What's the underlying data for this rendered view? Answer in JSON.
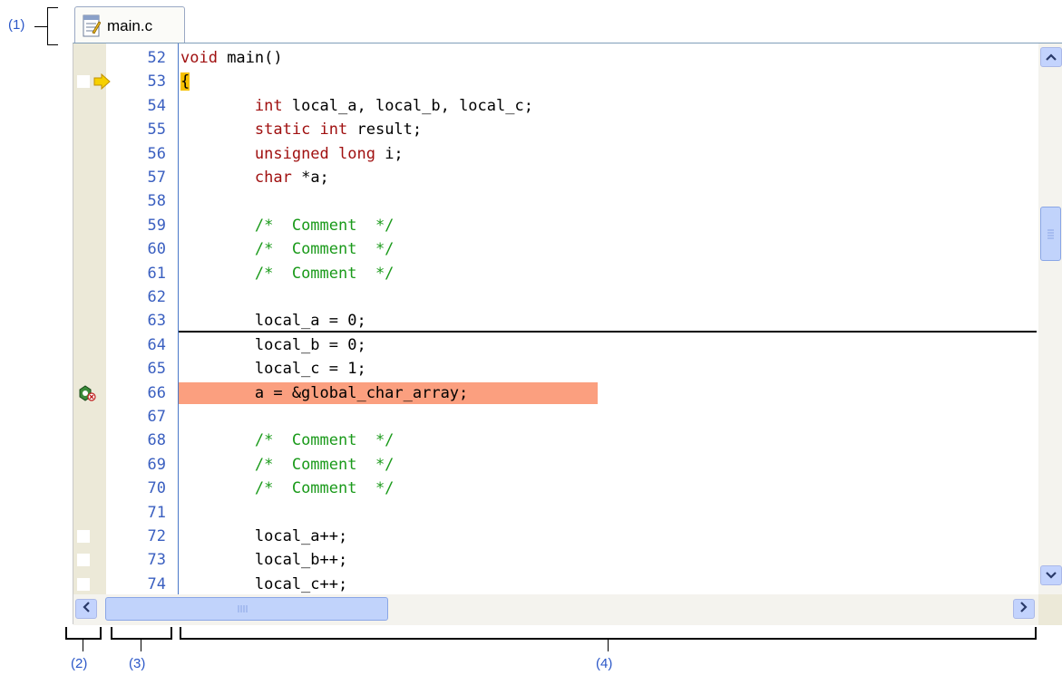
{
  "callouts": [
    "(1)",
    "(2)",
    "(3)",
    "(4)"
  ],
  "tab": {
    "label": "main.c",
    "icon": "document-icon"
  },
  "lines": [
    {
      "num": "52",
      "segments": [
        {
          "t": "void",
          "c": "kw"
        },
        {
          "t": " main()",
          "c": ""
        }
      ]
    },
    {
      "num": "53",
      "segments": [
        {
          "t": "{",
          "c": "cur-brace"
        }
      ],
      "marker": true,
      "arrow": true
    },
    {
      "num": "54",
      "segments": [
        {
          "t": "        ",
          "c": ""
        },
        {
          "t": "int",
          "c": "kw"
        },
        {
          "t": " local_a, local_b, local_c;",
          "c": ""
        }
      ]
    },
    {
      "num": "55",
      "segments": [
        {
          "t": "        ",
          "c": ""
        },
        {
          "t": "static int",
          "c": "kw"
        },
        {
          "t": " result;",
          "c": ""
        }
      ]
    },
    {
      "num": "56",
      "segments": [
        {
          "t": "        ",
          "c": ""
        },
        {
          "t": "unsigned long",
          "c": "kw"
        },
        {
          "t": " i;",
          "c": ""
        }
      ]
    },
    {
      "num": "57",
      "segments": [
        {
          "t": "        ",
          "c": ""
        },
        {
          "t": "char",
          "c": "kw"
        },
        {
          "t": " *a;",
          "c": ""
        }
      ]
    },
    {
      "num": "58",
      "segments": []
    },
    {
      "num": "59",
      "segments": [
        {
          "t": "        ",
          "c": ""
        },
        {
          "t": "/*  Comment  */",
          "c": "cm"
        }
      ]
    },
    {
      "num": "60",
      "segments": [
        {
          "t": "        ",
          "c": ""
        },
        {
          "t": "/*  Comment  */",
          "c": "cm"
        }
      ]
    },
    {
      "num": "61",
      "segments": [
        {
          "t": "        ",
          "c": ""
        },
        {
          "t": "/*  Comment  */",
          "c": "cm"
        }
      ]
    },
    {
      "num": "62",
      "segments": []
    },
    {
      "num": "63",
      "segments": [
        {
          "t": "        local_a = 0;",
          "c": ""
        }
      ]
    },
    {
      "num": "64",
      "segments": [
        {
          "t": "        local_b = 0;",
          "c": ""
        }
      ]
    },
    {
      "num": "65",
      "segments": [
        {
          "t": "        local_c = 1;",
          "c": ""
        }
      ]
    },
    {
      "num": "66",
      "segments": [
        {
          "t": "        a = &global_char_array;",
          "c": ""
        }
      ],
      "breakpoint": true
    },
    {
      "num": "67",
      "segments": []
    },
    {
      "num": "68",
      "segments": [
        {
          "t": "        ",
          "c": ""
        },
        {
          "t": "/*  Comment  */",
          "c": "cm"
        }
      ]
    },
    {
      "num": "69",
      "segments": [
        {
          "t": "        ",
          "c": ""
        },
        {
          "t": "/*  Comment  */",
          "c": "cm"
        }
      ]
    },
    {
      "num": "70",
      "segments": [
        {
          "t": "        ",
          "c": ""
        },
        {
          "t": "/*  Comment  */",
          "c": "cm"
        }
      ]
    },
    {
      "num": "71",
      "segments": []
    },
    {
      "num": "72",
      "segments": [
        {
          "t": "        local_a++;",
          "c": ""
        }
      ],
      "marker": true
    },
    {
      "num": "73",
      "segments": [
        {
          "t": "        local_b++;",
          "c": ""
        }
      ],
      "marker": true
    },
    {
      "num": "74",
      "segments": [
        {
          "t": "        local_c++;",
          "c": ""
        }
      ],
      "marker": true
    }
  ],
  "colors": {
    "keyword": "#a01010",
    "comment": "#1a9a1a",
    "line_number": "#3a5fc0",
    "breakpoint_line": "#fb9f7f",
    "current_pc": "#f6c000"
  }
}
